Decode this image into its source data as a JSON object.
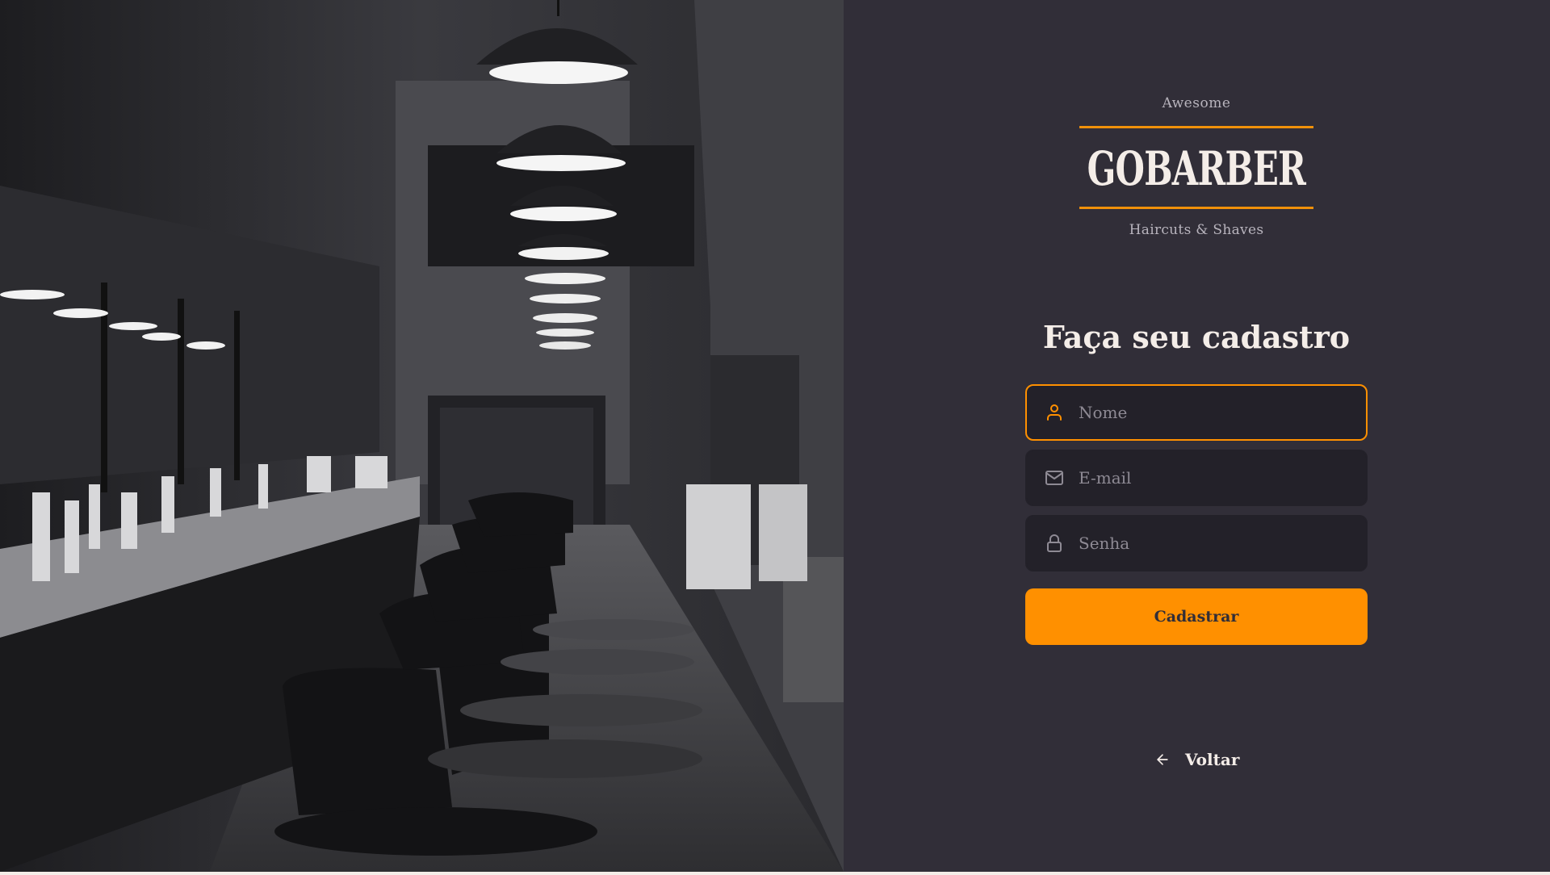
{
  "brand": {
    "tagline_top": "Awesome",
    "name": "GOBARBER",
    "tagline_bottom": "Haircuts & Shaves"
  },
  "form": {
    "title": "Faça seu cadastro",
    "name_field": {
      "placeholder": "Nome",
      "value": "",
      "icon": "user-icon",
      "focused": true
    },
    "email_field": {
      "placeholder": "E-mail",
      "value": "",
      "icon": "mail-icon"
    },
    "password_field": {
      "placeholder": "Senha",
      "value": "",
      "icon": "lock-icon"
    },
    "submit_label": "Cadastrar"
  },
  "back_link": {
    "label": "Voltar",
    "icon": "arrow-left-icon"
  },
  "colors": {
    "background": "#312e38",
    "input_background": "#232129",
    "accent": "#ff9000",
    "text": "#f4ede8",
    "placeholder": "#8e8a94"
  },
  "background_image": {
    "icon": "barbershop-photo"
  }
}
